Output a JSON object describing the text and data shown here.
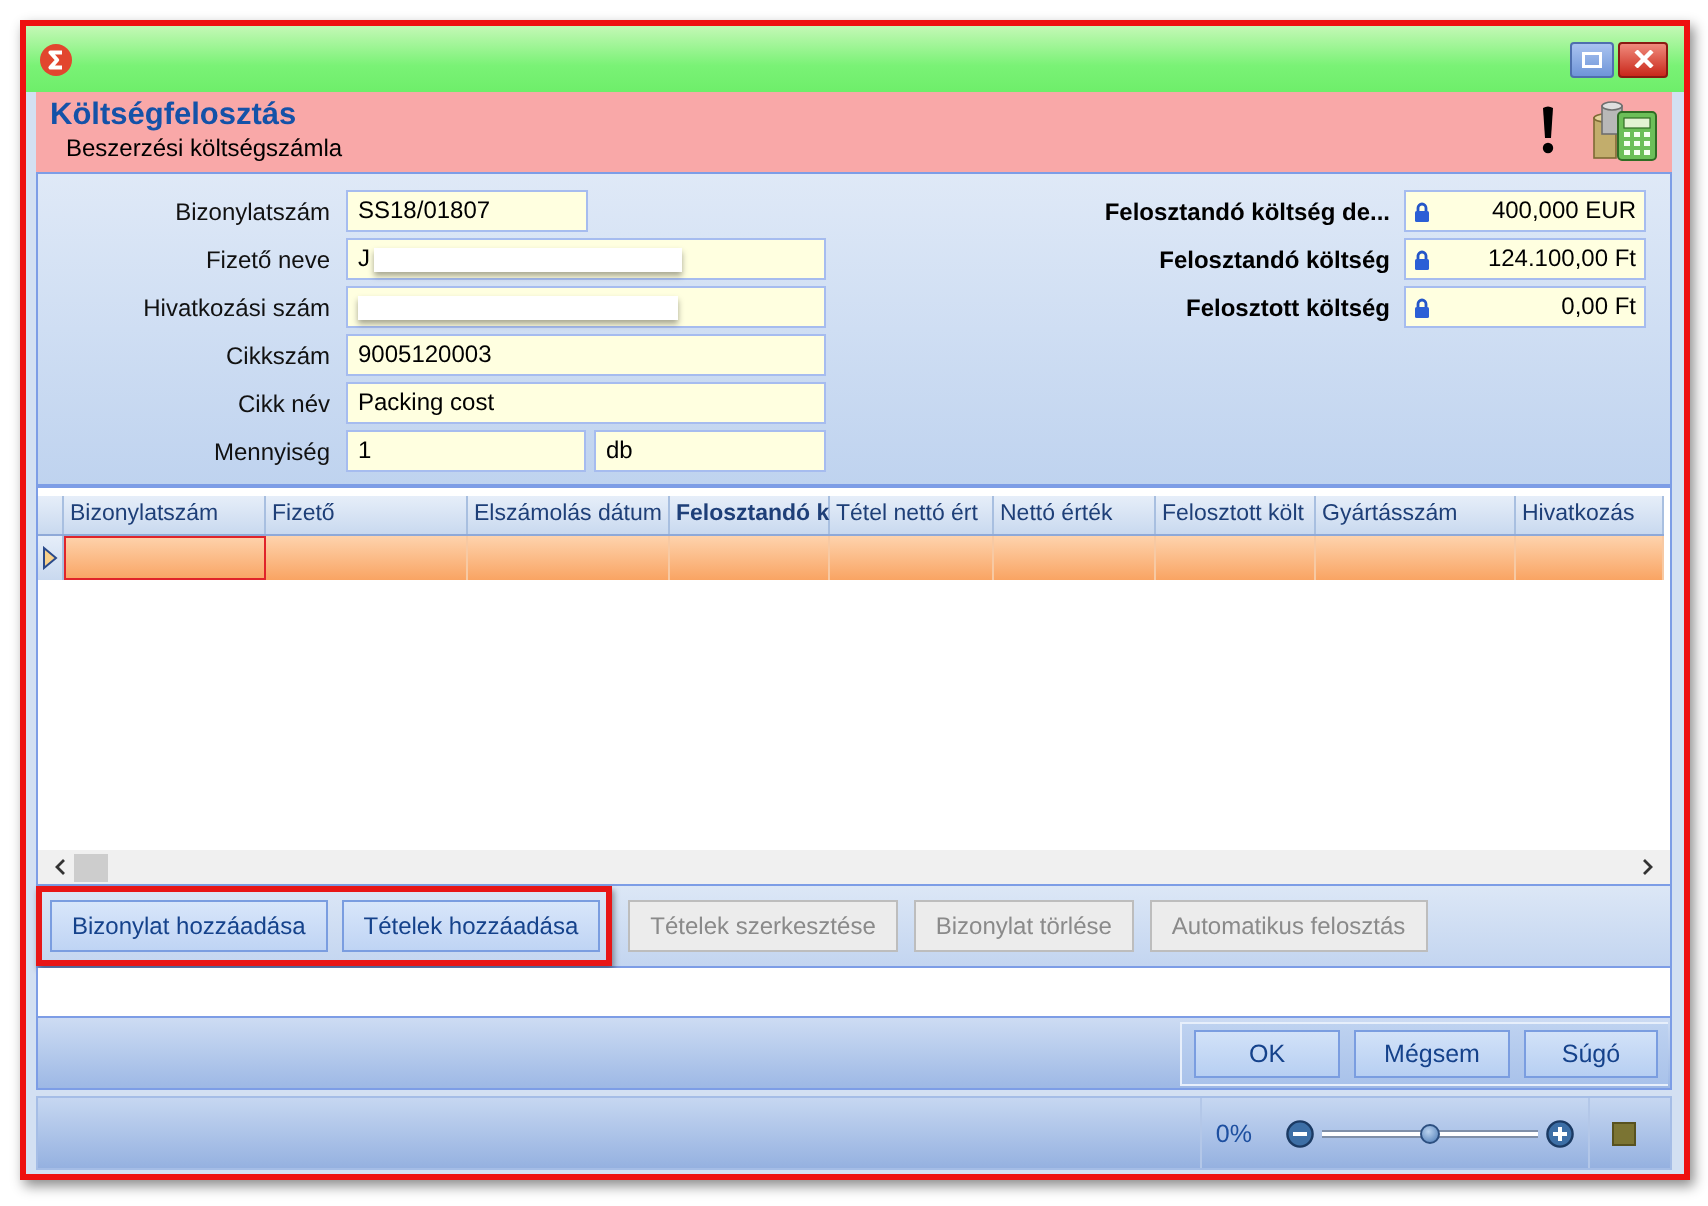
{
  "header": {
    "title": "Költségfelosztás",
    "subtitle": "Beszerzési költségszámla"
  },
  "form": {
    "fields": [
      {
        "label": "Bizonylatszám",
        "value": "SS18/01807",
        "kind": "short",
        "redacted": false
      },
      {
        "label": "Fizető neve",
        "value": "J",
        "kind": "wide",
        "redacted": true
      },
      {
        "label": "Hivatkozási szám",
        "kind": "wide",
        "redacted": true
      },
      {
        "label": "Cikkszám",
        "value": "9005120003",
        "kind": "wide",
        "redacted": false
      },
      {
        "label": "Cikk név",
        "value": "Packing cost",
        "kind": "wide",
        "redacted": false
      },
      {
        "label": "Mennyiség",
        "value": "1",
        "kind": "split",
        "unit": "db",
        "redacted": false
      }
    ],
    "totals": [
      {
        "label": "Felosztandó költség de...",
        "value": "400,000 EUR",
        "locked": true
      },
      {
        "label": "Felosztandó költség",
        "value": "124.100,00 Ft",
        "locked": true
      },
      {
        "label": "Felosztott költség",
        "value": "0,00 Ft",
        "locked": true
      }
    ]
  },
  "grid": {
    "columns": [
      {
        "label": "Bizonylatszám",
        "emphasized": false
      },
      {
        "label": "Fizető",
        "emphasized": false
      },
      {
        "label": "Elszámolás dátum",
        "emphasized": false
      },
      {
        "label": "Felosztandó k",
        "emphasized": true
      },
      {
        "label": "Tétel nettó ért",
        "emphasized": false
      },
      {
        "label": "Nettó érték",
        "emphasized": false
      },
      {
        "label": "Felosztott költ",
        "emphasized": false
      },
      {
        "label": "Gyártásszám",
        "emphasized": false
      },
      {
        "label": "Hivatkozás",
        "emphasized": false
      }
    ],
    "rows": [
      {
        "selected": true
      }
    ]
  },
  "actions": [
    {
      "label": "Bizonylat hozzáadása",
      "disabled": false,
      "highlighted": true
    },
    {
      "label": "Tételek hozzáadása",
      "disabled": false,
      "highlighted": true
    },
    {
      "label": "Tételek szerkesztése",
      "disabled": true,
      "highlighted": false
    },
    {
      "label": "Bizonylat törlése",
      "disabled": true,
      "highlighted": false
    },
    {
      "label": "Automatikus felosztás",
      "disabled": true,
      "highlighted": false
    }
  ],
  "dialog_buttons": [
    "OK",
    "Mégsem",
    "Súgó"
  ],
  "status_bar": {
    "zoom": {
      "reading": "0%",
      "level": 0.5
    }
  }
}
